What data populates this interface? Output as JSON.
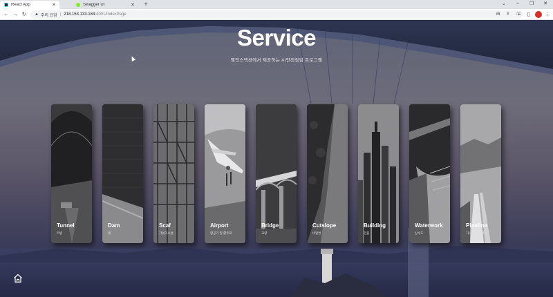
{
  "browser": {
    "tabs": [
      {
        "label": "React App",
        "active": true
      },
      {
        "label": "Swagger UI",
        "active": false
      }
    ],
    "new_tab": "+",
    "address": {
      "security_label": "주의 요함",
      "host": "218.153.133.184",
      "path": ":4001/IndexPage"
    }
  },
  "hero": {
    "title": "Service",
    "subtitle": "엠인스텍션에서 제공하는 AI안전점검 프로그램"
  },
  "services": [
    {
      "name": "Tunnel",
      "sub": "터널"
    },
    {
      "name": "Dam",
      "sub": "댐"
    },
    {
      "name": "Scaf",
      "sub": "가설가시설"
    },
    {
      "name": "Airport",
      "sub": "항공기 및 활주로"
    },
    {
      "name": "Bridge",
      "sub": "교량"
    },
    {
      "name": "Cutslope",
      "sub": "비탈면"
    },
    {
      "name": "Building",
      "sub": "건물"
    },
    {
      "name": "Waterwork",
      "sub": "상수도"
    },
    {
      "name": "Pipeline",
      "sub": "가스배관/열배관"
    }
  ],
  "icons": {
    "home": "home-icon"
  },
  "colors": {
    "page_bg": "#2a2e45",
    "title": "#ffffff",
    "card_bg": "#2c2c2e",
    "profile": "#d93025"
  }
}
